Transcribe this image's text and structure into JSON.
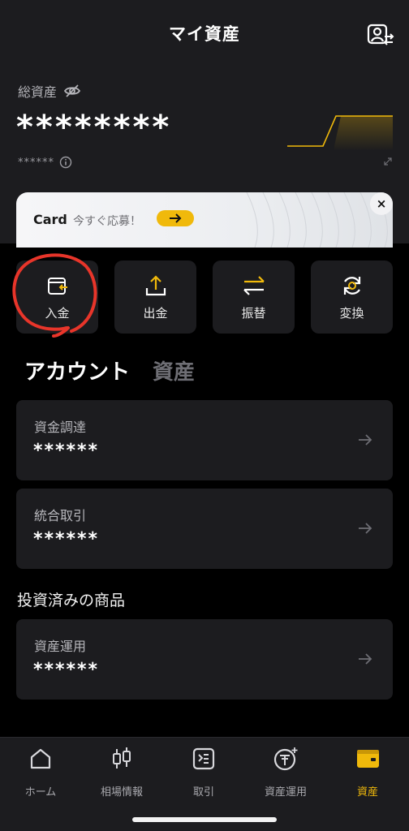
{
  "header": {
    "title": "マイ資産"
  },
  "summary": {
    "total_label": "総資産",
    "total_value": "********",
    "sub_value": "******"
  },
  "banner": {
    "card_label": "Card",
    "text": "今すぐ応募！",
    "close": "×"
  },
  "actions": [
    {
      "label": "入金",
      "icon": "deposit-icon"
    },
    {
      "label": "出金",
      "icon": "withdraw-icon"
    },
    {
      "label": "振替",
      "icon": "transfer-icon"
    },
    {
      "label": "変換",
      "icon": "convert-icon"
    }
  ],
  "tabs": [
    {
      "label": "アカウント",
      "active": true
    },
    {
      "label": "資産",
      "active": false
    }
  ],
  "accounts": [
    {
      "title": "資金調達",
      "value": "******"
    },
    {
      "title": "統合取引",
      "value": "******"
    }
  ],
  "invested": {
    "title": "投資済みの商品",
    "items": [
      {
        "title": "資産運用",
        "value": "******"
      }
    ]
  },
  "nav": [
    {
      "label": "ホーム",
      "icon": "home-icon",
      "active": false
    },
    {
      "label": "相場情報",
      "icon": "candlestick-icon",
      "active": false
    },
    {
      "label": "取引",
      "icon": "trade-icon",
      "active": false
    },
    {
      "label": "資産運用",
      "icon": "earn-icon",
      "active": false
    },
    {
      "label": "資産",
      "icon": "wallet-icon",
      "active": true
    }
  ],
  "colors": {
    "accent": "#f0b90b",
    "background": "#000000",
    "surface": "#1c1c1f",
    "annotation": "#e8352a"
  }
}
